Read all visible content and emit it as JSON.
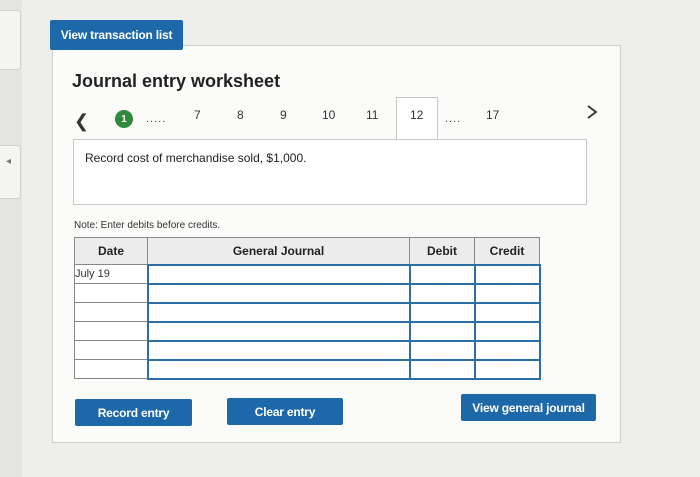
{
  "top_button": {
    "label": "View transaction list"
  },
  "worksheet": {
    "title": "Journal entry worksheet",
    "nav": {
      "first": "1",
      "dots_a": ".....",
      "n7": "7",
      "n8": "8",
      "n9": "9",
      "n10": "10",
      "n11": "11",
      "n12": "12",
      "dots_b": "....",
      "n17": "17",
      "active": "12"
    },
    "description": "Record cost of merchandise sold, $1,000.",
    "note": "Note: Enter debits before credits."
  },
  "table": {
    "headers": {
      "date": "Date",
      "general_journal": "General Journal",
      "debit": "Debit",
      "credit": "Credit"
    },
    "rows": [
      {
        "date": "July 19"
      },
      {
        "date": ""
      },
      {
        "date": ""
      },
      {
        "date": ""
      },
      {
        "date": ""
      },
      {
        "date": ""
      }
    ]
  },
  "buttons": {
    "record_entry": "Record entry",
    "clear_entry": "Clear entry",
    "view_general_journal": "View general journal"
  },
  "colors": {
    "button_blue": "#1d68a8",
    "step_green": "#2f8a3b"
  }
}
